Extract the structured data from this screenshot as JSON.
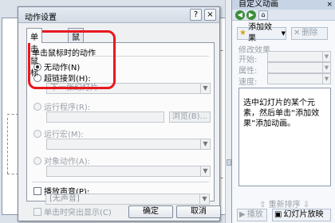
{
  "dialog": {
    "title": "动作设置",
    "help_icon": "?",
    "close_icon": "×",
    "tabs": [
      "单击鼠标",
      "鼠标移过"
    ],
    "group_title": "单击鼠标时的动作",
    "options": {
      "none": "无动作(N)",
      "hyperlink": "超链接到(H):",
      "hyperlink_value": "下一张幻灯片",
      "run_program": "运行程序(R):",
      "browse": "浏览(B)...",
      "run_macro": "运行宏(M):",
      "object_action": "对象动作(A):"
    },
    "sound_label": "播放声音(P):",
    "sound_value": "[无声音]",
    "highlight_click": "单击时突出显示(C)",
    "ok": "确定",
    "cancel": "取消",
    "highlight_color": "#e8181f"
  },
  "pane": {
    "title": "自定义动画",
    "close_icon": "×",
    "add_effect": "添加效果",
    "remove": "删除",
    "modify_label": "修改效果",
    "start_label": "开始:",
    "property_label": "属性:",
    "speed_label": "速度:",
    "hint": "选中幻灯片的某个元素，然后单击“添加效果”添加动画。",
    "reorder": "重新排序",
    "play": "播放",
    "slideshow": "幻灯片放映"
  }
}
